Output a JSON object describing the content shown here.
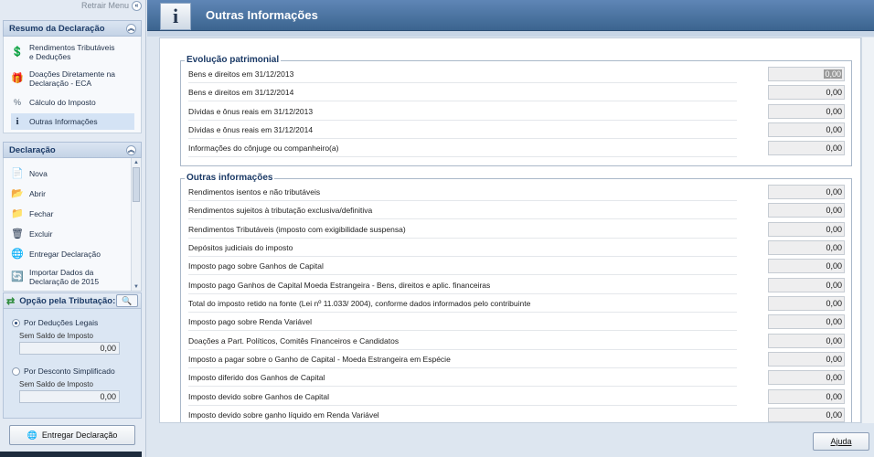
{
  "sidebar": {
    "retrair": "Retrair Menu",
    "resumo_title": "Resumo da Declaração",
    "resumo_items": [
      {
        "label": "Rendimentos Tributáveis e Deduções",
        "icon": "dollar-doc-icon"
      },
      {
        "label": "Doações Diretamente na Declaração - ECA",
        "icon": "gift-icon"
      },
      {
        "label": "Cálculo do Imposto",
        "icon": "percent-doc-icon"
      },
      {
        "label": "Outras Informações",
        "icon": "info-icon"
      }
    ],
    "declaracao_title": "Declaração",
    "declaracao_items": [
      {
        "label": "Nova",
        "icon": "new-doc-icon"
      },
      {
        "label": "Abrir",
        "icon": "open-folder-icon"
      },
      {
        "label": "Fechar",
        "icon": "folder-icon"
      },
      {
        "label": "Excluir",
        "icon": "trash-icon"
      },
      {
        "label": "Entregar Declaração",
        "icon": "globe-send-icon"
      },
      {
        "label": "Importar Dados da Declaração de 2015",
        "icon": "import-icon"
      }
    ],
    "opcao_title": "Opção pela Tributação:",
    "opcao_legais": "Por Deduções Legais",
    "opcao_legais_saldo_label": "Sem Saldo de Imposto",
    "opcao_legais_saldo_value": "0,00",
    "opcao_simplificado": "Por Desconto Simplificado",
    "opcao_simplificado_saldo_label": "Sem Saldo de Imposto",
    "opcao_simplificado_saldo_value": "0,00",
    "entregar_button": "Entregar Declaração"
  },
  "main": {
    "title": "Outras Informações",
    "evolucao_title": "Evolução patrimonial",
    "evolucao_rows": [
      {
        "label": "Bens e direitos em 31/12/2013",
        "value": "0,00"
      },
      {
        "label": "Bens e direitos em 31/12/2014",
        "value": "0,00"
      },
      {
        "label": "Dívidas e ônus reais em 31/12/2013",
        "value": "0,00"
      },
      {
        "label": "Dívidas e ônus reais em 31/12/2014",
        "value": "0,00"
      },
      {
        "label": "Informações do cônjuge ou companheiro(a)",
        "value": "0,00"
      }
    ],
    "outras_title": "Outras informações",
    "outras_rows": [
      {
        "label": "Rendimentos isentos e não tributáveis",
        "value": "0,00"
      },
      {
        "label": "Rendimentos sujeitos à tributação exclusiva/definitiva",
        "value": "0,00"
      },
      {
        "label": "Rendimentos Tributáveis (imposto com exigibilidade suspensa)",
        "value": "0,00"
      },
      {
        "label": "Depósitos judiciais do imposto",
        "value": "0,00"
      },
      {
        "label": "Imposto pago sobre Ganhos de Capital",
        "value": "0,00"
      },
      {
        "label": "Imposto pago Ganhos de Capital Moeda Estrangeira - Bens, direitos e aplic. financeiras",
        "value": "0,00"
      },
      {
        "label": "Total do imposto retido na fonte (Lei nº 11.033/ 2004), conforme dados informados pelo contribuinte",
        "value": "0,00"
      },
      {
        "label": "Imposto pago sobre Renda Variável",
        "value": "0,00"
      },
      {
        "label": "Doações a Part. Políticos, Comitês Financeiros e Candidatos",
        "value": "0,00"
      },
      {
        "label": "Imposto a pagar sobre o Ganho de Capital - Moeda Estrangeira em Espécie",
        "value": "0,00"
      },
      {
        "label": "Imposto diferido dos Ganhos de Capital",
        "value": "0,00"
      },
      {
        "label": "Imposto devido sobre Ganhos de Capital",
        "value": "0,00"
      },
      {
        "label": "Imposto devido sobre ganho líquido em Renda Variável",
        "value": "0,00"
      }
    ],
    "ajuda_button": "Ajuda"
  }
}
